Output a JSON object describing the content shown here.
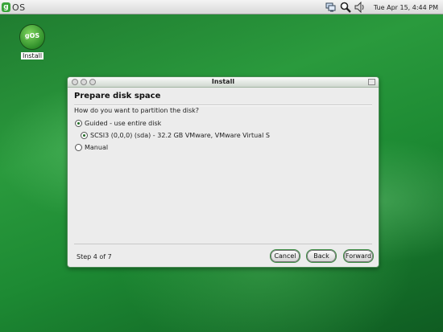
{
  "topbar": {
    "logo_letter": "g",
    "logo_text": "OS",
    "clock": "Tue Apr 15,  4:44 PM",
    "icons": [
      "network-icon",
      "magnifier-icon",
      "volume-icon"
    ]
  },
  "desktop": {
    "icon_badge": "gOS",
    "icon_label": "Install"
  },
  "window": {
    "title": "Install",
    "heading": "Prepare disk space",
    "question": "How do you want to partition the disk?",
    "options": [
      {
        "label": "Guided - use entire disk",
        "selected": true
      },
      {
        "label": "SCSI3 (0,0,0) (sda) - 32.2 GB VMware, VMware Virtual S",
        "selected": true
      },
      {
        "label": "Manual",
        "selected": false
      }
    ],
    "step": "Step 4 of 7",
    "buttons": {
      "cancel": "Cancel",
      "back": "Back",
      "forward": "Forward"
    }
  },
  "colors": {
    "accent": "#2a9a3d",
    "window_border": "#4c8c55"
  }
}
